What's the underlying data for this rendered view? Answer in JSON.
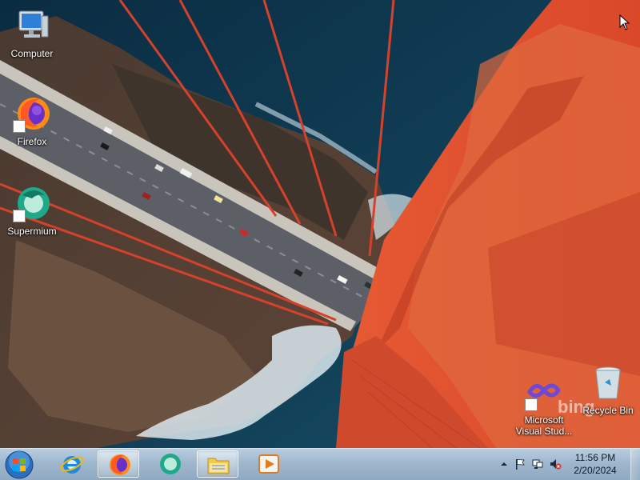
{
  "desktop": {
    "icons": [
      {
        "label": "Computer",
        "icon": "computer-icon"
      },
      {
        "label": "Firefox",
        "icon": "firefox-icon"
      },
      {
        "label": "Supermium",
        "icon": "supermium-icon"
      },
      {
        "label": "Microsoft Visual Stud...",
        "icon": "visual-studio-icon"
      },
      {
        "label": "Recycle Bin",
        "icon": "recycle-bin-icon"
      }
    ],
    "watermark": "bing"
  },
  "taskbar": {
    "pinned": [
      {
        "name": "Start",
        "icon": "windows-orb-icon"
      },
      {
        "name": "Internet Explorer",
        "icon": "internet-explorer-icon"
      },
      {
        "name": "Firefox",
        "icon": "firefox-icon",
        "active": true
      },
      {
        "name": "Supermium",
        "icon": "supermium-icon"
      },
      {
        "name": "File Explorer",
        "icon": "folder-icon"
      },
      {
        "name": "Media Player",
        "icon": "media-player-icon"
      }
    ],
    "tray": {
      "icons": [
        "show-hidden-icons-icon",
        "action-center-flag-icon",
        "network-icon",
        "volume-muted-icon"
      ],
      "time": "11:56 PM",
      "date": "2/20/2024"
    }
  },
  "colors": {
    "bridge_orange": "#e0512c",
    "ocean": "#0f3a52",
    "taskbar": "#a4bcd2"
  }
}
